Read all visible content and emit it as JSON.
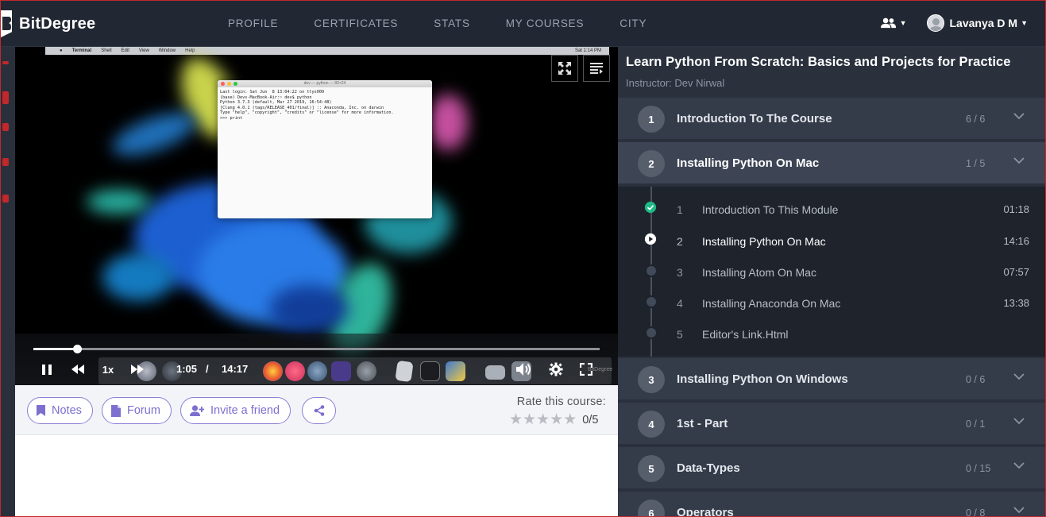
{
  "app": {
    "brand": "BitDegree"
  },
  "nav": {
    "items": [
      "PROFILE",
      "CERTIFICATES",
      "STATS",
      "MY COURSES",
      "CITY"
    ]
  },
  "user": {
    "name": "Lavanya D M",
    "icons": [
      "people-icon",
      "avatar"
    ]
  },
  "player": {
    "mac_menubar": [
      "Terminal",
      "Shell",
      "Edit",
      "View",
      "Window",
      "Help"
    ],
    "mac_clock": "Sat 1:14 PM",
    "terminal_title": "dev — python — 80×24",
    "terminal_lines": "Last login: Sat Jun  8 13:04:22 on ttys000\n(base) Devs-MacBook-Air:~ dev$ python\nPython 3.7.3 (default, Mar 27 2019, 16:54:48)\n[Clang 4.0.1 (tags/RELEASE_401/final)] :: Anaconda, Inc. on darwin\nType \"help\", \"copyright\", \"credits\" or \"license\" for more information.\n>>> print",
    "speed": "1x",
    "current_time": "1:05",
    "separator": "/",
    "duration": "14:17",
    "progress": 0.077,
    "watermark": "BitDegree",
    "colors": {
      "accent": "#7c6fd0",
      "brand_red": "#c0282c",
      "complete_green": "#1db885"
    }
  },
  "actions": {
    "notes": "Notes",
    "forum": "Forum",
    "invite": "Invite a friend",
    "rate_label": "Rate this course:",
    "rating_value": "0/5",
    "stars_filled": 0,
    "stars_total": 5
  },
  "course": {
    "title": "Learn Python From Scratch: Basics and Projects for Practice",
    "instructor": "Instructor: Dev Nirwal",
    "sections": [
      {
        "num": "1",
        "title": "Introduction To The Course",
        "count": "6 / 6"
      },
      {
        "num": "2",
        "title": "Installing Python On Mac",
        "count": "1 / 5"
      },
      {
        "num": "3",
        "title": "Installing Python On Windows",
        "count": "0 / 6"
      },
      {
        "num": "4",
        "title": "1st - Part",
        "count": "0 / 1"
      },
      {
        "num": "5",
        "title": "Data-Types",
        "count": "0 / 15"
      },
      {
        "num": "6",
        "title": "Operators",
        "count": "0 / 8"
      }
    ],
    "lessons": [
      {
        "num": "1",
        "title": "Introduction To This Module",
        "duration": "01:18",
        "state": "complete"
      },
      {
        "num": "2",
        "title": "Installing Python On Mac",
        "duration": "14:16",
        "state": "current"
      },
      {
        "num": "3",
        "title": "Installing Atom On Mac",
        "duration": "07:57",
        "state": "pending"
      },
      {
        "num": "4",
        "title": "Installing Anaconda On Mac",
        "duration": "13:38",
        "state": "pending"
      },
      {
        "num": "5",
        "title": "Editor's Link.Html",
        "duration": "",
        "state": "pending"
      }
    ]
  }
}
